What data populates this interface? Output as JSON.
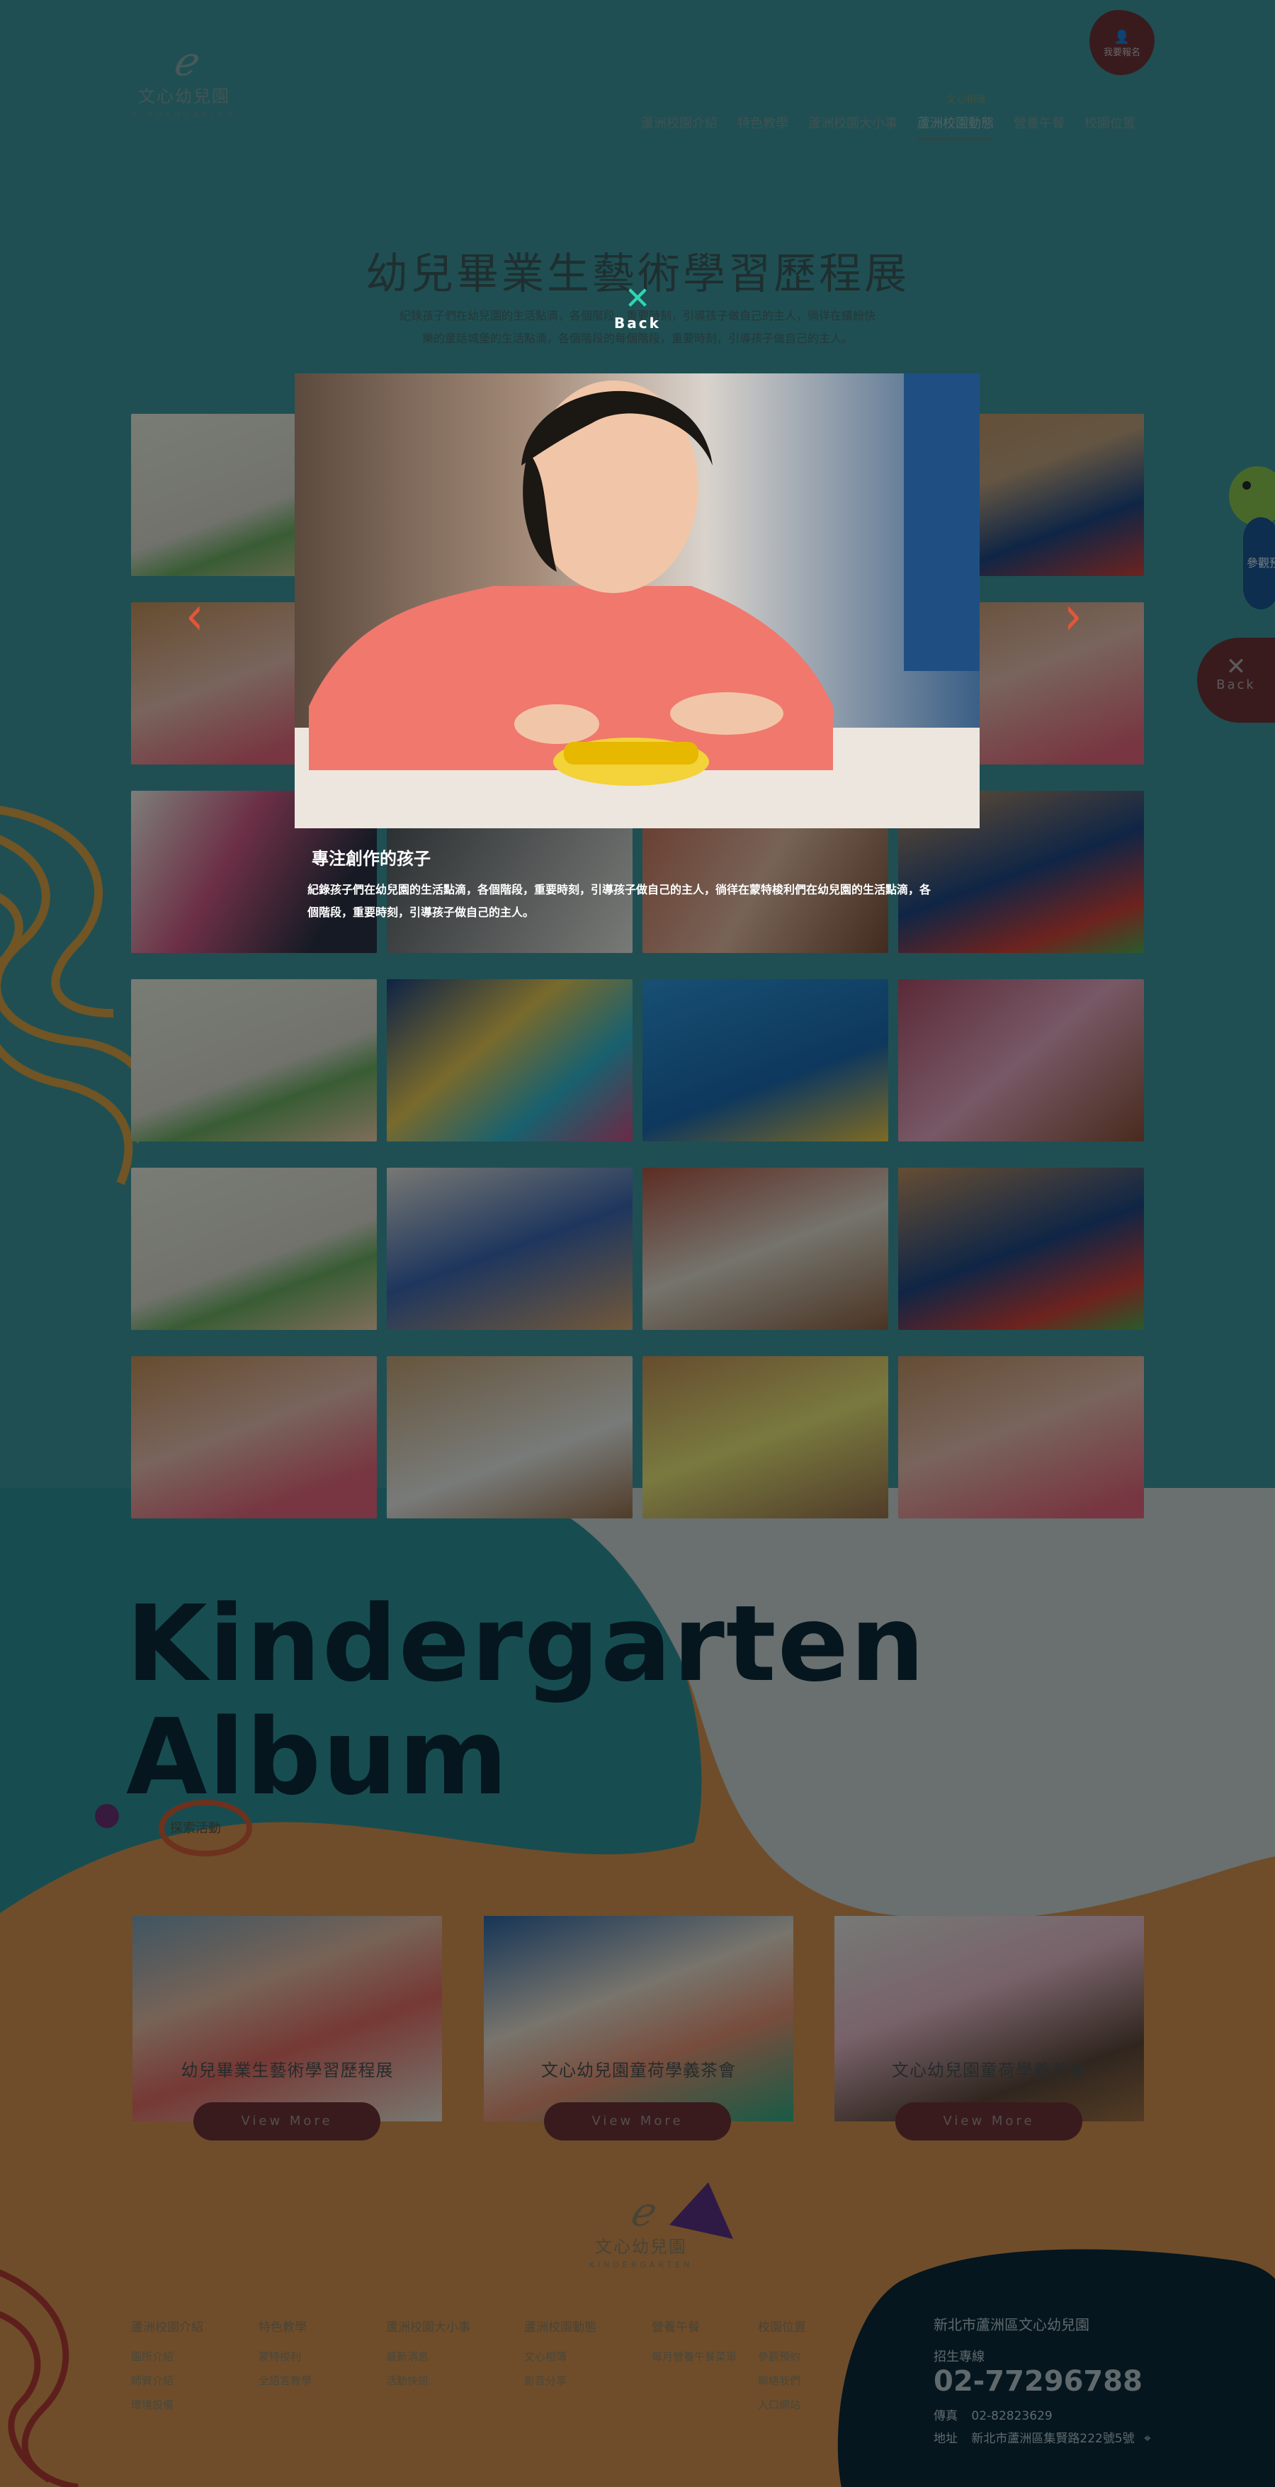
{
  "header": {
    "logo_name": "文心幼兒園",
    "logo_sub": "KINDERGARTEN",
    "signup_label": "我要報名",
    "nav": [
      {
        "label": "蘆洲校園介紹"
      },
      {
        "label": "特色教學"
      },
      {
        "label": "蘆洲校園大小事"
      },
      {
        "label": "蘆洲校園動態",
        "active": true
      },
      {
        "label": "營養午餐"
      },
      {
        "label": "校園位置"
      }
    ],
    "nav_sub": "文心相簿"
  },
  "page": {
    "title": "幼兒畢業生藝術學習歷程展",
    "desc": "紀錄孩子們在幼兒園的生活點滴，各個階段，重要時刻，引導孩子做自己的主人，徜徉在繽紛快樂的童話城堡的生活點滴，各個階段的每個階段，重要時刻，引導孩子做自己的主人。"
  },
  "side": {
    "reserve_label": "參觀預約",
    "back_label": "Back"
  },
  "album_section": {
    "title_line1": "Kindergarten",
    "title_line2": "Album",
    "more_label": "探索活動",
    "cards": [
      {
        "caption": "幼兒畢業生藝術學習歷程展",
        "button": "View More"
      },
      {
        "caption": "文心幼兒園童荷學義茶會",
        "button": "View More"
      },
      {
        "caption": "文心幼兒園童荷學義茶會",
        "button": "View More"
      }
    ]
  },
  "footer": {
    "logo_name": "文心幼兒園",
    "logo_sub": "KINDERGARTEN",
    "columns": [
      {
        "heading": "蘆洲校園介紹",
        "items": [
          "園所介紹",
          "師資介紹",
          "環境設備"
        ]
      },
      {
        "heading": "特色教學",
        "items": [
          "蒙特梭利",
          "全語言教學"
        ]
      },
      {
        "heading": "蘆洲校園大小事",
        "items": [
          "最新消息",
          "活動快訊"
        ]
      },
      {
        "heading": "蘆洲校園動態",
        "items": [
          "文心相簿",
          "影音分享"
        ]
      },
      {
        "heading": "營養午餐",
        "items": [
          "每月營養午餐菜單"
        ]
      },
      {
        "heading": "校園位置",
        "items": [
          "參觀預約",
          "聯絡我們",
          "入口網站"
        ]
      }
    ],
    "contact": {
      "name": "新北市蘆洲區文心幼兒園",
      "hotline_label": "招生專線",
      "phone": "02-77296788",
      "fax_label": "傳真",
      "fax": "02-82823629",
      "address_label": "地址",
      "address": "新北市蘆洲區集賢路222號5號"
    }
  },
  "lightbox": {
    "close_label": "Back",
    "title": "專注創作的孩子",
    "desc": "紀錄孩子們在幼兒園的生活點滴，各個階段，重要時刻，引導孩子做自己的主人，徜徉在蒙特梭利們在幼兒園的生活點滴，各個階段，重要時刻，引導孩子做自己的主人。"
  },
  "colors": {
    "accent_teal": "#2fd6b3",
    "accent_red": "#e5553a",
    "navy": "#0a2230"
  }
}
